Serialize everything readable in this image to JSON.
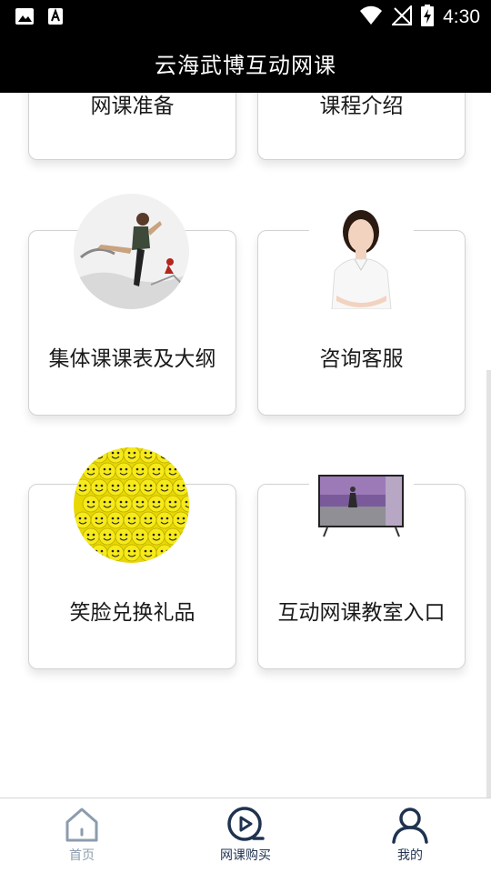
{
  "status_bar": {
    "time": "4:30",
    "icons": [
      "image-icon",
      "font-a-icon",
      "wifi-icon",
      "no-signal-icon",
      "battery-charging-icon"
    ]
  },
  "header": {
    "title": "云海武博互动网课"
  },
  "cards": [
    {
      "label": "网课准备"
    },
    {
      "label": "课程介绍"
    },
    {
      "label": "集体课课表及大纲",
      "image": "martial-arts-kick-photo"
    },
    {
      "label": "咨询客服",
      "image": "customer-service-woman-photo"
    },
    {
      "label": "笑脸兑换礼品",
      "image": "smiley-faces-photo"
    },
    {
      "label": "互动网课教室入口",
      "image": "tv-classroom-photo"
    }
  ],
  "bottom_nav": {
    "items": [
      {
        "label": "首页",
        "icon": "home-icon",
        "active": false
      },
      {
        "label": "网课购买",
        "icon": "play-circle-icon",
        "active": true
      },
      {
        "label": "我的",
        "icon": "user-icon",
        "active": false
      }
    ],
    "colors": {
      "active": "#1f3350",
      "inactive": "#8c9cae"
    }
  }
}
